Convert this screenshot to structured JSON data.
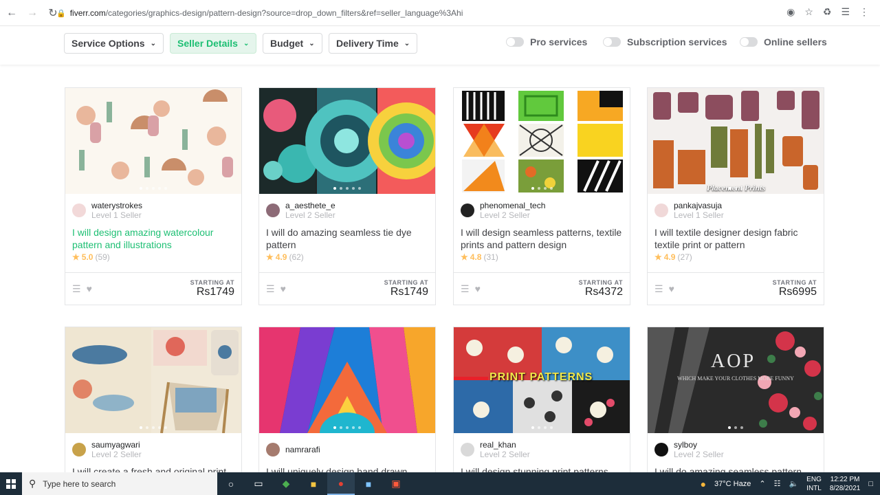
{
  "browser": {
    "url_host": "fiverr.com",
    "url_path": "/categories/graphics-design/pattern-design?source=drop_down_filters&ref=seller_language%3Ahi"
  },
  "filters": {
    "service_options": "Service Options",
    "seller_details": "Seller Details",
    "budget": "Budget",
    "delivery_time": "Delivery Time",
    "pro_services": "Pro services",
    "subscription_services": "Subscription services",
    "online_sellers": "Online sellers"
  },
  "gigs": [
    {
      "seller": "waterystrokes",
      "level": "Level 1 Seller",
      "title": "I will design amazing watercolour pattern and illustrations",
      "rating": "5.0",
      "count": "(59)",
      "starting_at": "STARTING AT",
      "price": "Rs1749"
    },
    {
      "seller": "a_aesthete_e",
      "level": "Level 2 Seller",
      "title": "I will do amazing seamless tie dye pattern",
      "rating": "4.9",
      "count": "(62)",
      "starting_at": "STARTING AT",
      "price": "Rs1749"
    },
    {
      "seller": "phenomenal_tech",
      "level": "Level 2 Seller",
      "title": "I will design seamless patterns, textile prints and pattern design",
      "rating": "4.8",
      "count": "(31)",
      "starting_at": "STARTING AT",
      "price": "Rs4372"
    },
    {
      "seller": "pankajvasuja",
      "level": "Level 1 Seller",
      "title": "I will textile designer design fabric textile print or pattern",
      "rating": "4.9",
      "count": "(27)",
      "starting_at": "STARTING AT",
      "price": "Rs6995",
      "thumb_text": "Placement Prints"
    },
    {
      "seller": "saumyagwari",
      "level": "Level 2 Seller",
      "title": "I will create a fresh and original print"
    },
    {
      "seller": "namrarafi",
      "level": "",
      "title": "I will uniquely design hand drawn"
    },
    {
      "seller": "real_khan",
      "level": "Level 2 Seller",
      "title": "I will design stunning print patterns",
      "thumb_text": "PRINT PATTERNS"
    },
    {
      "seller": "sylboy",
      "level": "Level 2 Seller",
      "title": "I will do amazing seamless pattern",
      "thumb_text": "AOP",
      "thumb_sub": "WHICH MAKE YOUR CLOTHES MORE FUNNY"
    }
  ],
  "taskbar": {
    "search_placeholder": "Type here to search",
    "weather": "37°C  Haze",
    "lang_1": "ENG",
    "lang_2": "INTL",
    "time": "12:22 PM",
    "date": "8/28/2021"
  }
}
